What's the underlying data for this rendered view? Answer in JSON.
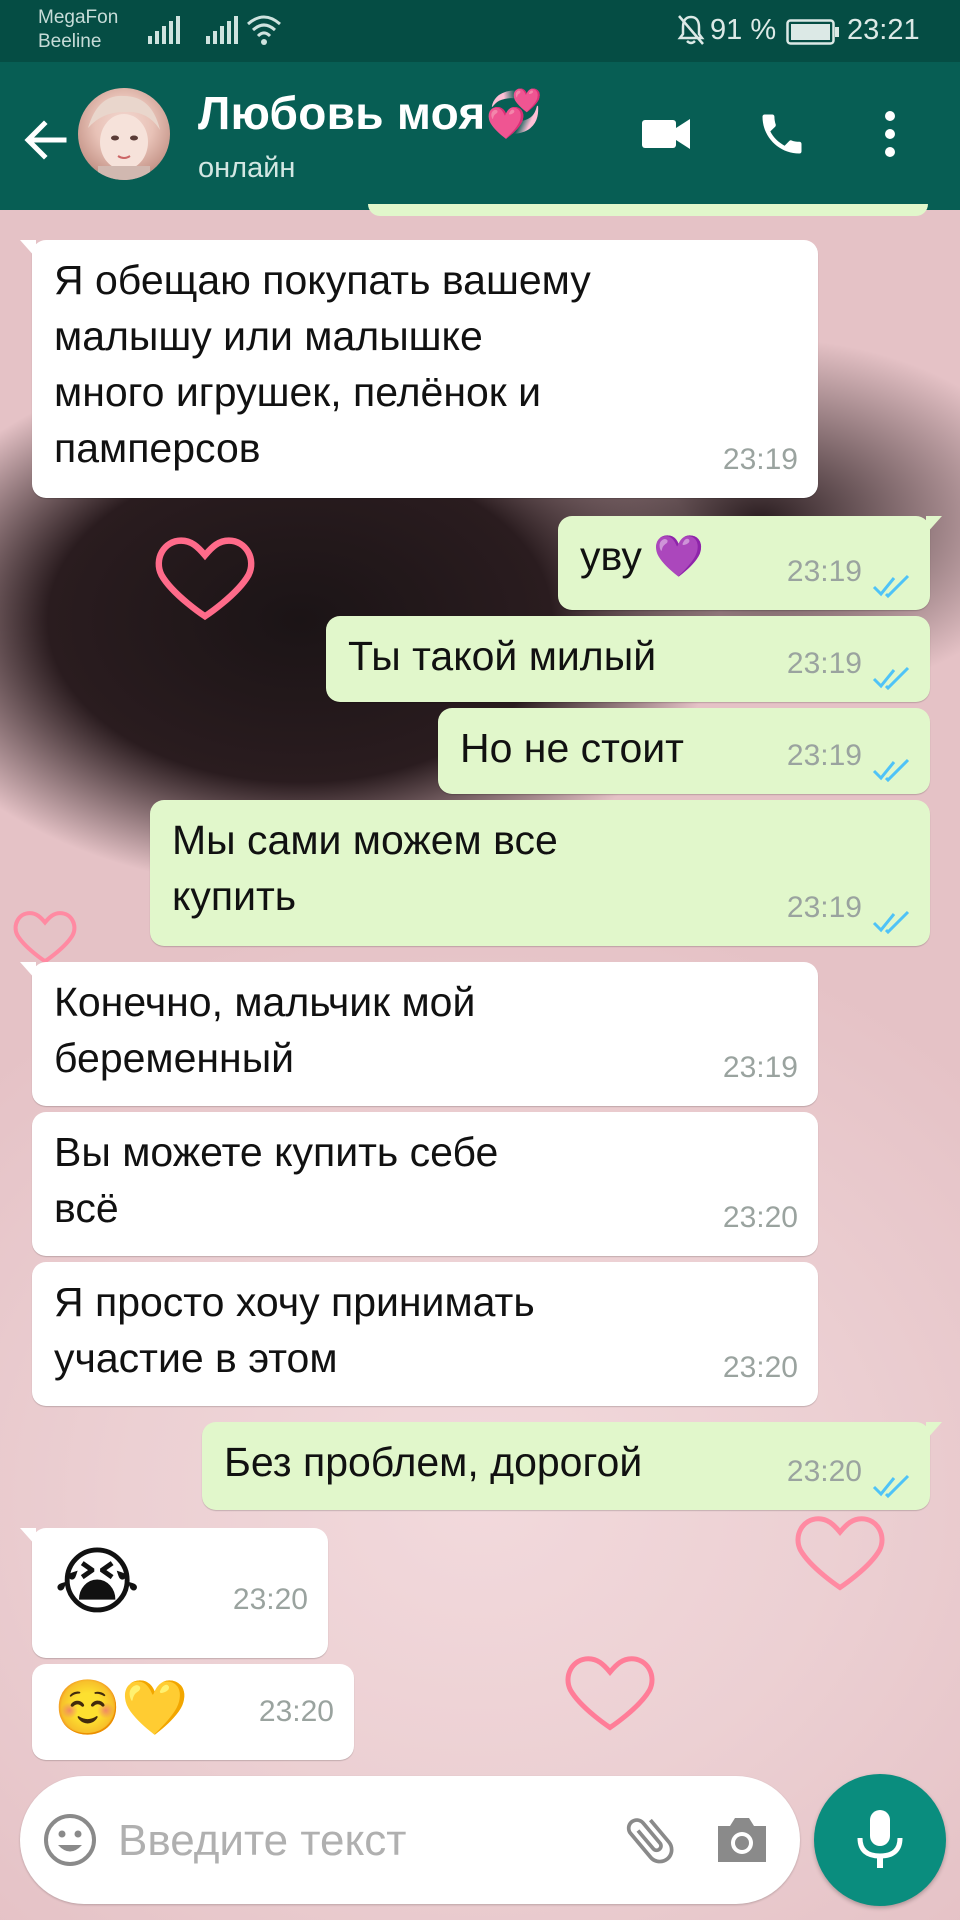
{
  "status_bar": {
    "carrier_1": "MegaFon",
    "carrier_2": "Beeline",
    "battery_percent": "91 %",
    "time": "23:21"
  },
  "header": {
    "contact_name": "Любовь моя💞",
    "contact_status": "онлайн"
  },
  "messages": [
    {
      "direction": "in",
      "lines": [
        "Я обещаю покупать вашему",
        "малышу или малышке",
        "много игрушек, пелёнок и",
        "памперсов"
      ],
      "time": "23:19"
    },
    {
      "direction": "out",
      "lines": [
        "уву 💜"
      ],
      "time": "23:19",
      "read": true
    },
    {
      "direction": "out",
      "lines": [
        "Ты такой милый"
      ],
      "time": "23:19",
      "read": true
    },
    {
      "direction": "out",
      "lines": [
        "Но не стоит"
      ],
      "time": "23:19",
      "read": true
    },
    {
      "direction": "out",
      "lines": [
        "Мы сами можем все",
        "купить"
      ],
      "time": "23:19",
      "read": true
    },
    {
      "direction": "in",
      "lines": [
        "Конечно, мальчик мой",
        "беременный"
      ],
      "time": "23:19"
    },
    {
      "direction": "in",
      "lines": [
        "Вы можете купить себе",
        "всё"
      ],
      "time": "23:20"
    },
    {
      "direction": "in",
      "lines": [
        "Я просто хочу принимать",
        "участие в этом"
      ],
      "time": "23:20"
    },
    {
      "direction": "out",
      "lines": [
        "Без проблем, дорогой"
      ],
      "time": "23:20",
      "read": true
    },
    {
      "direction": "in",
      "lines": [
        "😭"
      ],
      "time": "23:20"
    },
    {
      "direction": "in",
      "lines": [
        "☺️💛"
      ],
      "time": "23:20"
    }
  ],
  "input": {
    "placeholder": "Введите текст"
  },
  "colors": {
    "header": "#075e54",
    "status_bar": "#054d44",
    "outgoing_bubble": "#e1f7cb",
    "incoming_bubble": "#ffffff",
    "read_ticks": "#4fc3f7",
    "mic_button": "#0a8d7e"
  },
  "icons": {
    "back": "arrow-left-icon",
    "video": "video-camera-icon",
    "call": "phone-icon",
    "menu": "more-vertical-icon",
    "emoji": "emoji-icon",
    "attach": "paperclip-icon",
    "camera": "camera-icon",
    "mic": "microphone-icon"
  }
}
